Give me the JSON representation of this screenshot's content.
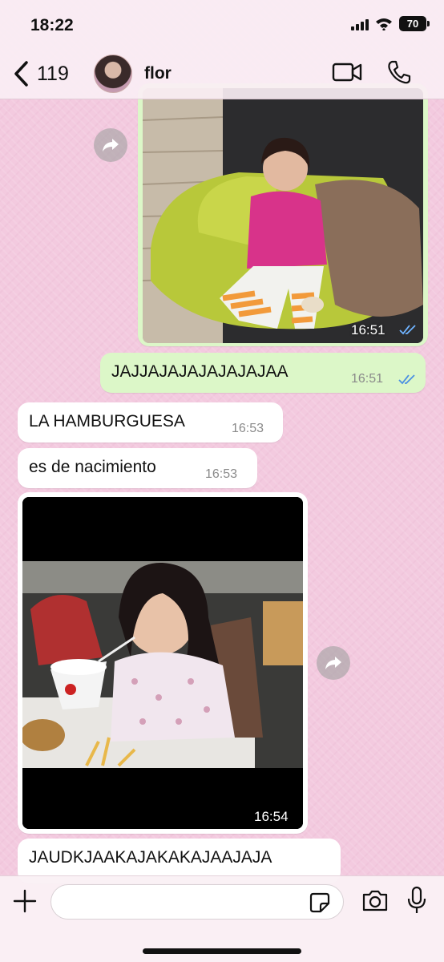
{
  "status_bar": {
    "time": "18:22",
    "battery": "70"
  },
  "header": {
    "back_count": "119",
    "contact_name": "flor"
  },
  "messages": [
    {
      "type": "image",
      "direction": "outgoing",
      "time": "16:51",
      "read": true
    },
    {
      "type": "text",
      "direction": "outgoing",
      "text": "JAJJAJAJAJAJAJAJAA",
      "time": "16:51",
      "read": true
    },
    {
      "type": "text",
      "direction": "incoming",
      "text": "LA HAMBURGUESA",
      "time": "16:53"
    },
    {
      "type": "text",
      "direction": "incoming",
      "text": "es de nacimiento",
      "time": "16:53"
    },
    {
      "type": "image",
      "direction": "incoming",
      "time": "16:54"
    },
    {
      "type": "text",
      "direction": "incoming",
      "text": "JAUDKJAAKAJAKAKAJAAJAJA",
      "time": ""
    }
  ],
  "input": {
    "value": "",
    "placeholder": ""
  },
  "colors": {
    "outgoing_bubble": "#dcf7c8",
    "incoming_bubble": "#ffffff",
    "read_ticks": "#4a90e2",
    "wallpaper": "#f3cadf"
  }
}
